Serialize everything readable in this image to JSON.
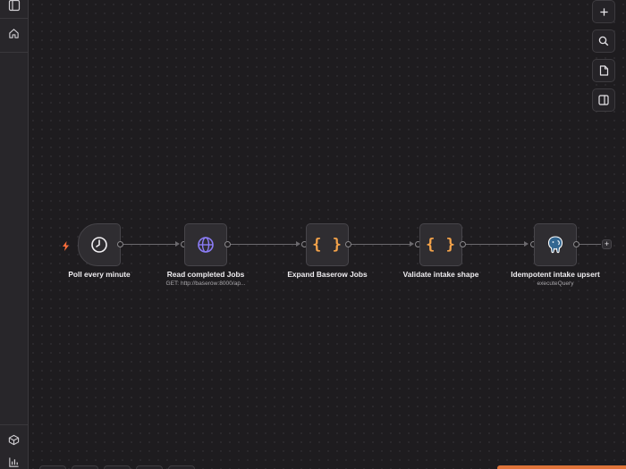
{
  "sidebar": {
    "icons": [
      "sidebar-toggle-icon",
      "home-icon",
      "cube-icon",
      "chart-icon"
    ]
  },
  "toolbar": {
    "icons": [
      "plus-icon",
      "search-icon",
      "note-icon",
      "panel-icon"
    ]
  },
  "workflow": {
    "trigger_icon": "lightning-icon",
    "nodes": [
      {
        "label": "Poll every minute",
        "subtitle": "",
        "icon": "clock-icon"
      },
      {
        "label": "Read completed Jobs",
        "subtitle": "GET: http://baserow:8000/ap...",
        "icon": "globe-icon"
      },
      {
        "label": "Expand Baserow Jobs",
        "subtitle": "",
        "icon": "braces-icon",
        "glyph": "{ }"
      },
      {
        "label": "Validate intake shape",
        "subtitle": "",
        "icon": "braces-icon",
        "glyph": "{ }"
      },
      {
        "label": "Idempotent intake upsert",
        "subtitle": "executeQuery",
        "icon": "postgres-elephant-icon"
      }
    ],
    "add_node_symbol": "+"
  },
  "colors": {
    "background": "#1e1c1f",
    "node_bg": "#2f2d31",
    "code_node": "#f4a34a",
    "http_node": "#8b7cf6",
    "trigger": "#ff6d3a",
    "postgres": "#336791"
  }
}
